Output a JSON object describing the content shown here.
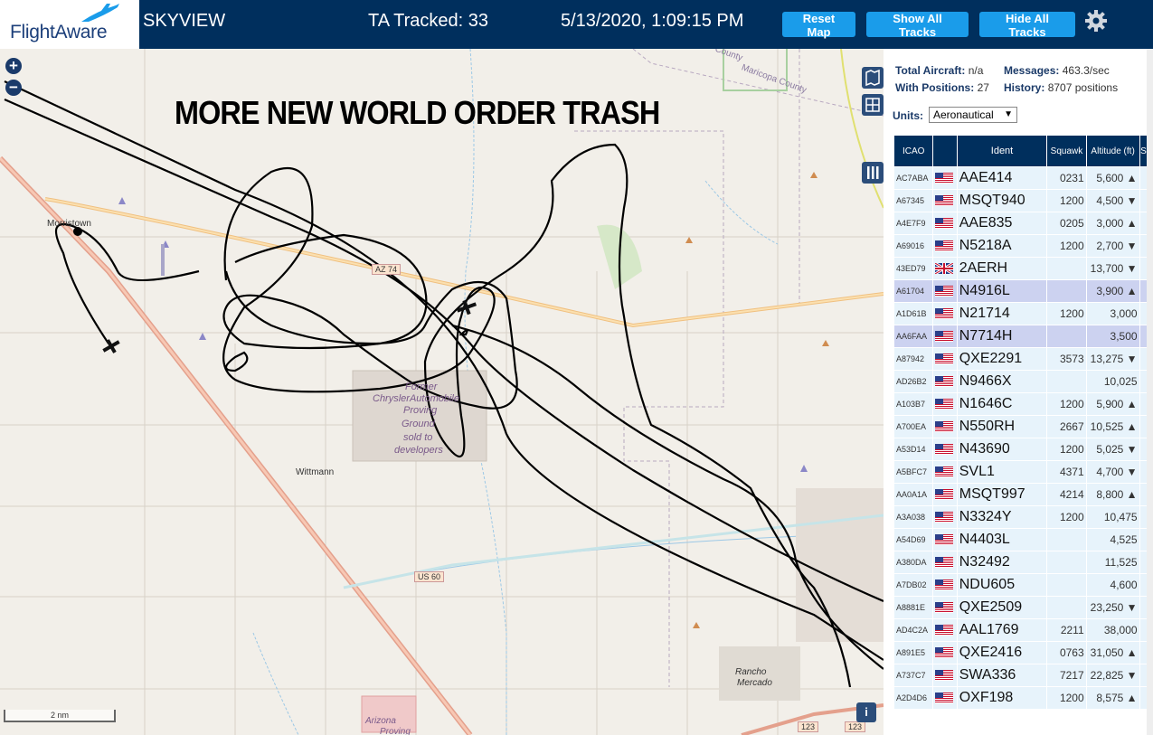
{
  "header": {
    "logo": "FlightAware",
    "app_title": "SKYVIEW",
    "tracked": "TA Tracked: 33",
    "datetime": "5/13/2020, 1:09:15 PM",
    "buttons": {
      "reset": "Reset Map",
      "show": "Show All Tracks",
      "hide": "Hide All Tracks"
    }
  },
  "map": {
    "caption": "MORE NEW WORLD ORDER TRASH",
    "zoom_in": "+",
    "zoom_out": "−",
    "labels": {
      "morristown": "Morristown",
      "wittmann": "Wittmann",
      "maricopa1": "Maricopa County",
      "maricopa2": "County",
      "former": "Former",
      "chrysler": "ChryslerAutomobile",
      "proving": "Proving",
      "ground": "Ground",
      "sold": "sold to",
      "developers": "developers",
      "rancho": "Rancho",
      "mercado": "Mercado",
      "arizona": "Arizona",
      "proving2": "Proving"
    },
    "shields": {
      "az74": "AZ 74",
      "us60": "US 60",
      "r123a": "123",
      "r123b": "123"
    },
    "scale": "2 nm",
    "info": "i"
  },
  "sidebar": {
    "stats": {
      "total_label": "Total Aircraft:",
      "total_value": "n/a",
      "messages_label": "Messages:",
      "messages_value": "463.3/sec",
      "positions_label": "With Positions:",
      "positions_value": "27",
      "history_label": "History:",
      "history_value": "8707 positions"
    },
    "units_label": "Units:",
    "units_value": "Aeronautical",
    "columns": [
      "ICAO",
      "",
      "Ident",
      "Squawk",
      "Altitude (ft)",
      "Sp"
    ],
    "rows": [
      {
        "icao": "AC7ABA",
        "flag": "us",
        "ident": "AAE414",
        "squawk": "0231",
        "alt": "5,600 ▲",
        "sel": false
      },
      {
        "icao": "A67345",
        "flag": "us",
        "ident": "MSQT940",
        "squawk": "1200",
        "alt": "4,500 ▼",
        "sel": false
      },
      {
        "icao": "A4E7F9",
        "flag": "us",
        "ident": "AAE835",
        "squawk": "0205",
        "alt": "3,000 ▲",
        "sel": false
      },
      {
        "icao": "A69016",
        "flag": "us",
        "ident": "N5218A",
        "squawk": "1200",
        "alt": "2,700 ▼",
        "sel": false
      },
      {
        "icao": "43ED79",
        "flag": "uk",
        "ident": "2AERH",
        "squawk": "",
        "alt": "13,700 ▼",
        "sel": false
      },
      {
        "icao": "A61704",
        "flag": "us",
        "ident": "N4916L",
        "squawk": "",
        "alt": "3,900 ▲",
        "sel": true
      },
      {
        "icao": "A1D61B",
        "flag": "us",
        "ident": "N21714",
        "squawk": "1200",
        "alt": "3,000",
        "sel": false
      },
      {
        "icao": "AA6FAA",
        "flag": "us",
        "ident": "N7714H",
        "squawk": "",
        "alt": "3,500",
        "sel": true
      },
      {
        "icao": "A87942",
        "flag": "us",
        "ident": "QXE2291",
        "squawk": "3573",
        "alt": "13,275 ▼",
        "sel": false
      },
      {
        "icao": "AD26B2",
        "flag": "us",
        "ident": "N9466X",
        "squawk": "",
        "alt": "10,025",
        "sel": false
      },
      {
        "icao": "A103B7",
        "flag": "us",
        "ident": "N1646C",
        "squawk": "1200",
        "alt": "5,900 ▲",
        "sel": false
      },
      {
        "icao": "A700EA",
        "flag": "us",
        "ident": "N550RH",
        "squawk": "2667",
        "alt": "10,525 ▲",
        "sel": false
      },
      {
        "icao": "A53D14",
        "flag": "us",
        "ident": "N43690",
        "squawk": "1200",
        "alt": "5,025 ▼",
        "sel": false
      },
      {
        "icao": "A5BFC7",
        "flag": "us",
        "ident": "SVL1",
        "squawk": "4371",
        "alt": "4,700 ▼",
        "sel": false
      },
      {
        "icao": "AA0A1A",
        "flag": "us",
        "ident": "MSQT997",
        "squawk": "4214",
        "alt": "8,800 ▲",
        "sel": false
      },
      {
        "icao": "A3A038",
        "flag": "us",
        "ident": "N3324Y",
        "squawk": "1200",
        "alt": "10,475",
        "sel": false
      },
      {
        "icao": "A54D69",
        "flag": "us",
        "ident": "N4403L",
        "squawk": "",
        "alt": "4,525",
        "sel": false
      },
      {
        "icao": "A380DA",
        "flag": "us",
        "ident": "N32492",
        "squawk": "",
        "alt": "11,525",
        "sel": false
      },
      {
        "icao": "A7DB02",
        "flag": "us",
        "ident": "NDU605",
        "squawk": "",
        "alt": "4,600",
        "sel": false
      },
      {
        "icao": "A8881E",
        "flag": "us",
        "ident": "QXE2509",
        "squawk": "",
        "alt": "23,250 ▼",
        "sel": false
      },
      {
        "icao": "AD4C2A",
        "flag": "us",
        "ident": "AAL1769",
        "squawk": "2211",
        "alt": "38,000",
        "sel": false
      },
      {
        "icao": "A891E5",
        "flag": "us",
        "ident": "QXE2416",
        "squawk": "0763",
        "alt": "31,050 ▲",
        "sel": false
      },
      {
        "icao": "A737C7",
        "flag": "us",
        "ident": "SWA336",
        "squawk": "7217",
        "alt": "22,825 ▼",
        "sel": false
      },
      {
        "icao": "A2D4D6",
        "flag": "us",
        "ident": "OXF198",
        "squawk": "1200",
        "alt": "8,575 ▲",
        "sel": false
      }
    ]
  }
}
